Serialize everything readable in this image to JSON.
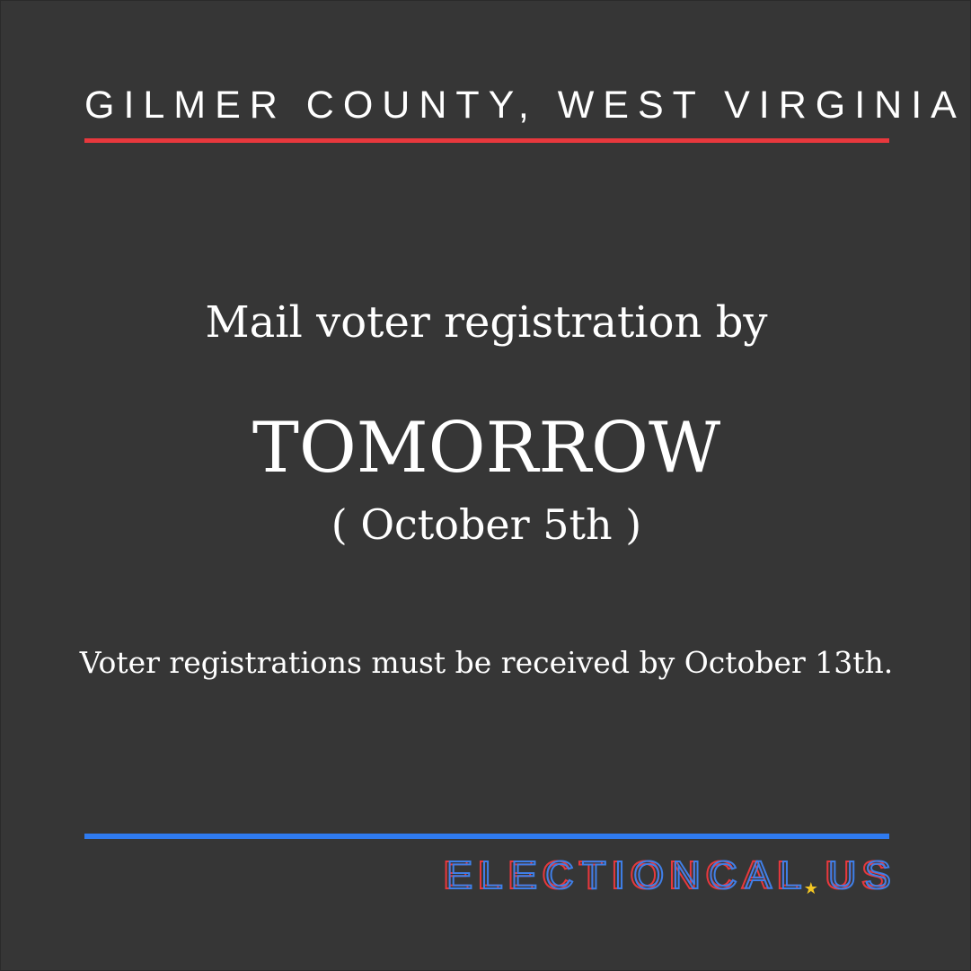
{
  "header": {
    "county": "GILMER COUNTY, WEST VIRGINIA"
  },
  "message": {
    "headline": "Mail voter registration by",
    "deadline": "TOMORROW",
    "date": "( October 5th )",
    "note": "Voter registrations must be received by October 13th."
  },
  "footer": {
    "brand_letters": [
      "E",
      "L",
      "E",
      "C",
      "T",
      "I",
      "O",
      "N",
      "C",
      "A",
      "L"
    ],
    "brand_star": "★",
    "brand_suffix_letters": [
      "U",
      "S"
    ]
  },
  "colors": {
    "background": "#363636",
    "accent_red": "#e8383d",
    "accent_blue": "#2f7bf0",
    "star_yellow": "#f3c623",
    "text": "#ffffff"
  }
}
